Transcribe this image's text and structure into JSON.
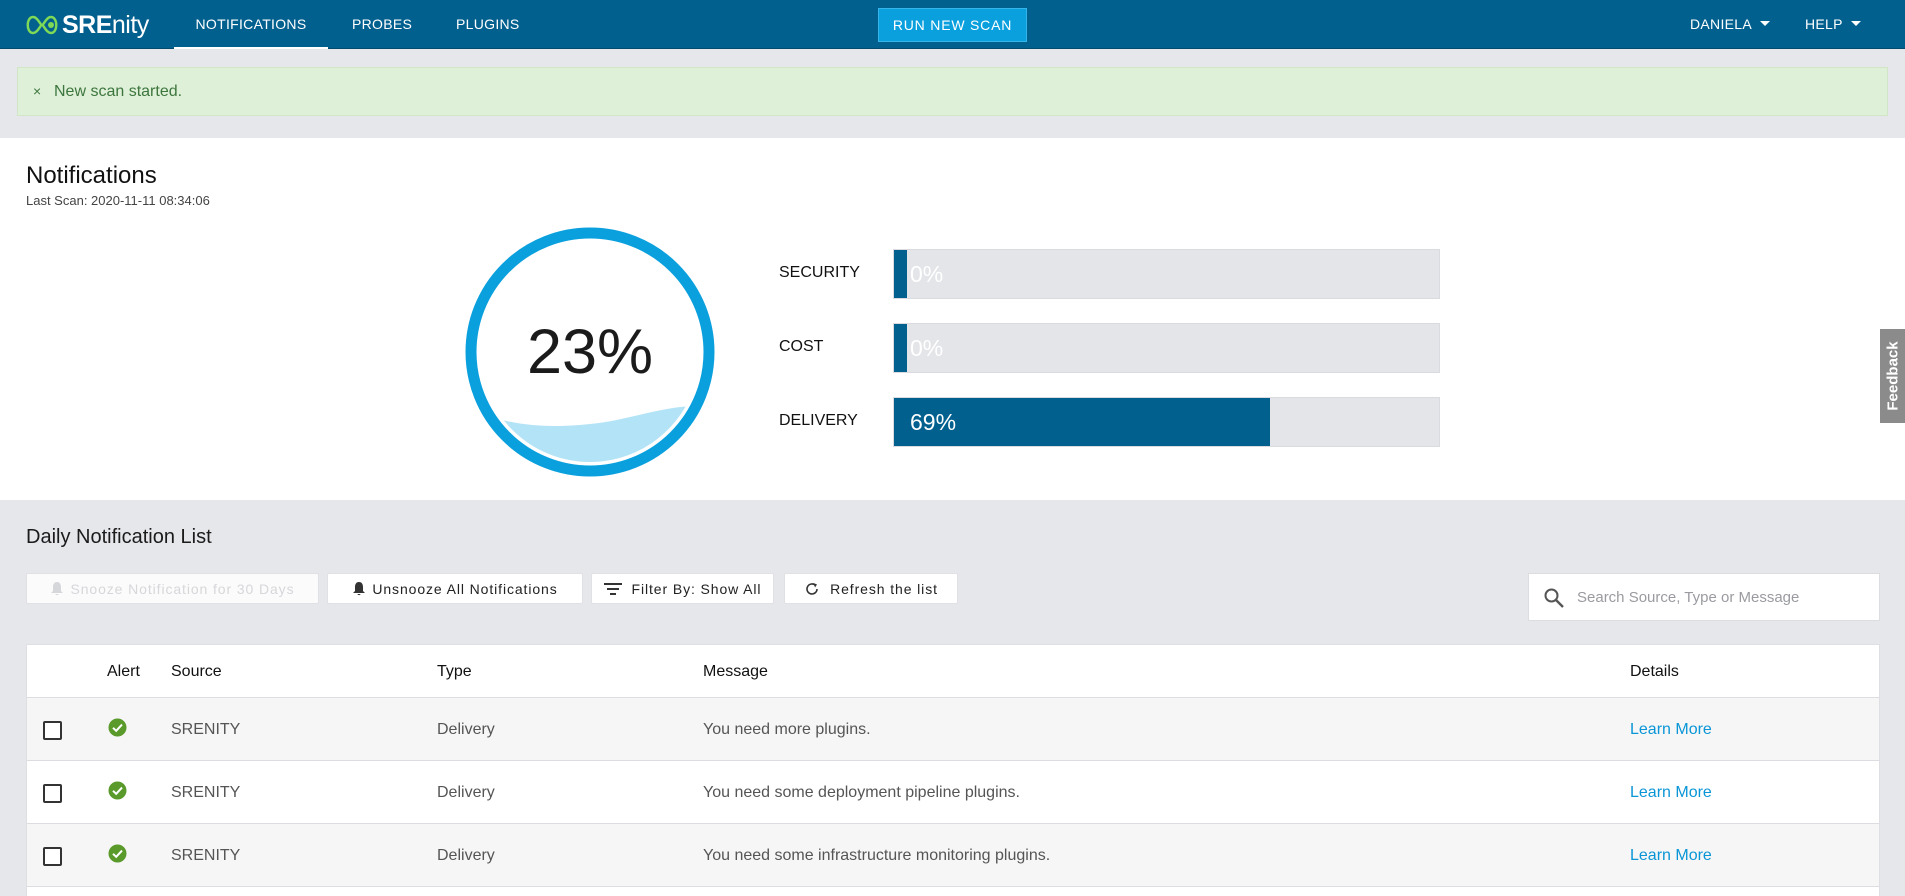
{
  "app": {
    "name_bold": "SRE",
    "name_light": "nity"
  },
  "nav": {
    "tabs": [
      {
        "label": "NOTIFICATIONS",
        "active": true
      },
      {
        "label": "PROBES",
        "active": false
      },
      {
        "label": "PLUGINS",
        "active": false
      }
    ],
    "run_scan_label": "RUN NEW SCAN",
    "user_menu": "DANIELA",
    "help_menu": "HELP"
  },
  "alert": {
    "close_glyph": "×",
    "message": "New scan started."
  },
  "summary": {
    "title": "Notifications",
    "last_scan": "Last Scan: 2020-11-11 08:34:06",
    "overall_label": "23%",
    "overall_value": 23,
    "bars": [
      {
        "label": "SECURITY",
        "value_label": "0%",
        "value": 0
      },
      {
        "label": "COST",
        "value_label": "0%",
        "value": 0
      },
      {
        "label": "DELIVERY",
        "value_label": "69%",
        "value": 69
      }
    ]
  },
  "list": {
    "title": "Daily Notification List",
    "buttons": {
      "snooze": "Snooze Notification for 30 Days",
      "unsnooze": "Unsnooze All Notifications",
      "filter": "Filter By: Show All",
      "refresh": "Refresh the list"
    },
    "search_placeholder": "Search Source, Type or Message",
    "columns": {
      "alert": "Alert",
      "source": "Source",
      "type": "Type",
      "message": "Message",
      "details": "Details"
    },
    "rows": [
      {
        "source": "SRENITY",
        "type": "Delivery",
        "message": "You need more plugins.",
        "details": "Learn More"
      },
      {
        "source": "SRENITY",
        "type": "Delivery",
        "message": "You need some deployment pipeline plugins.",
        "details": "Learn More"
      },
      {
        "source": "SRENITY",
        "type": "Delivery",
        "message": "You need some infrastructure monitoring plugins.",
        "details": "Learn More"
      }
    ]
  },
  "feedback_label": "Feedback",
  "colors": {
    "nav": "#02608f",
    "accent": "#0aa0de",
    "success_bg": "#dff0d8",
    "success_text": "#3c763d",
    "ok_icon": "#5a9a2b",
    "link": "#0a96d6"
  },
  "icons": {
    "logo": "srenity-logo-icon",
    "check": "check-circle-icon",
    "bell": "bell-icon",
    "filter": "filter-lines-icon",
    "refresh": "refresh-icon",
    "search": "search-icon"
  }
}
